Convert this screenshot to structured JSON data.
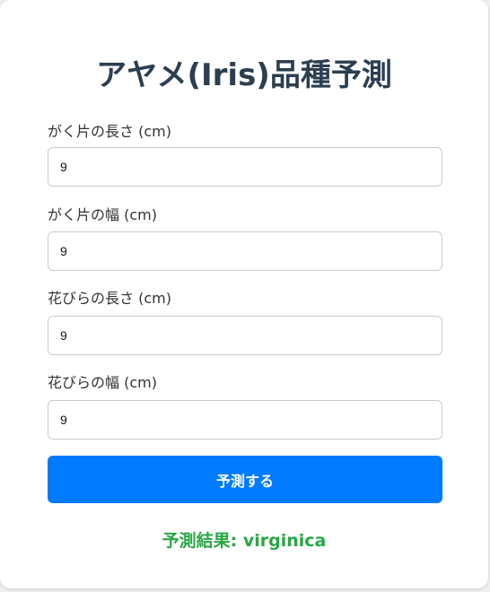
{
  "title": "アヤメ(Iris)品種予測",
  "fields": [
    {
      "label": "がく片の長さ (cm)",
      "value": "9"
    },
    {
      "label": "がく片の幅 (cm)",
      "value": "9"
    },
    {
      "label": "花びらの長さ (cm)",
      "value": "9"
    },
    {
      "label": "花びらの幅 (cm)",
      "value": "9"
    }
  ],
  "submit_label": "予測する",
  "result_text": "予測結果: virginica",
  "colors": {
    "accent": "#007bff",
    "result": "#28a745",
    "title": "#2c3e50"
  }
}
